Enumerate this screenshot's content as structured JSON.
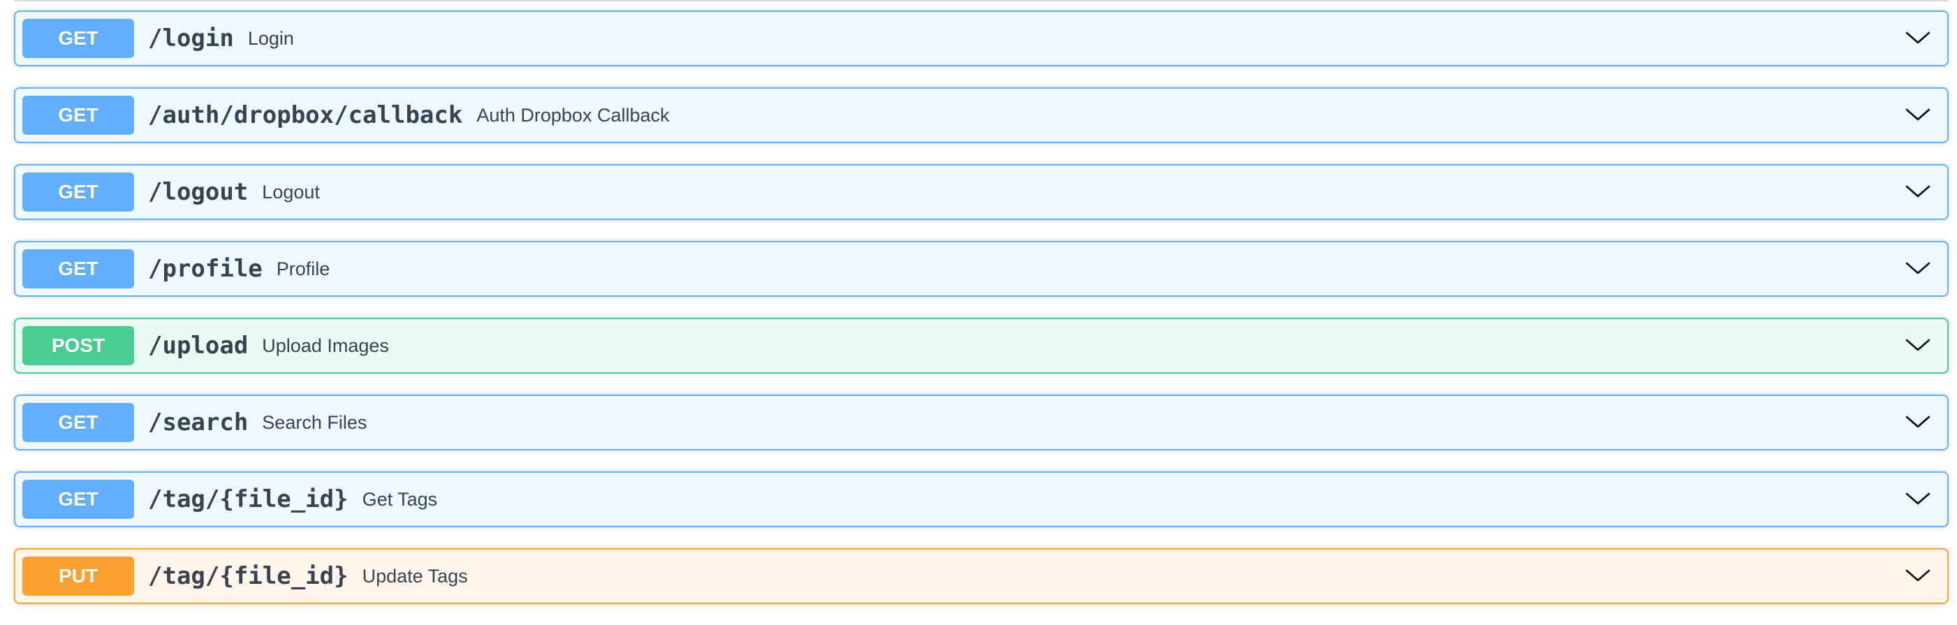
{
  "operations": [
    {
      "method": "GET",
      "path": "/login",
      "summary": "Login"
    },
    {
      "method": "GET",
      "path": "/auth/dropbox/callback",
      "summary": "Auth Dropbox Callback"
    },
    {
      "method": "GET",
      "path": "/logout",
      "summary": "Logout"
    },
    {
      "method": "GET",
      "path": "/profile",
      "summary": "Profile"
    },
    {
      "method": "POST",
      "path": "/upload",
      "summary": "Upload Images"
    },
    {
      "method": "GET",
      "path": "/search",
      "summary": "Search Files"
    },
    {
      "method": "GET",
      "path": "/tag/{file_id}",
      "summary": "Get Tags"
    },
    {
      "method": "PUT",
      "path": "/tag/{file_id}",
      "summary": "Update Tags"
    }
  ],
  "colors": {
    "get": "#61affe",
    "post": "#49cc90",
    "put": "#fca130",
    "text": "#3b4151"
  },
  "icons": {
    "expand": "chevron-down-icon"
  }
}
